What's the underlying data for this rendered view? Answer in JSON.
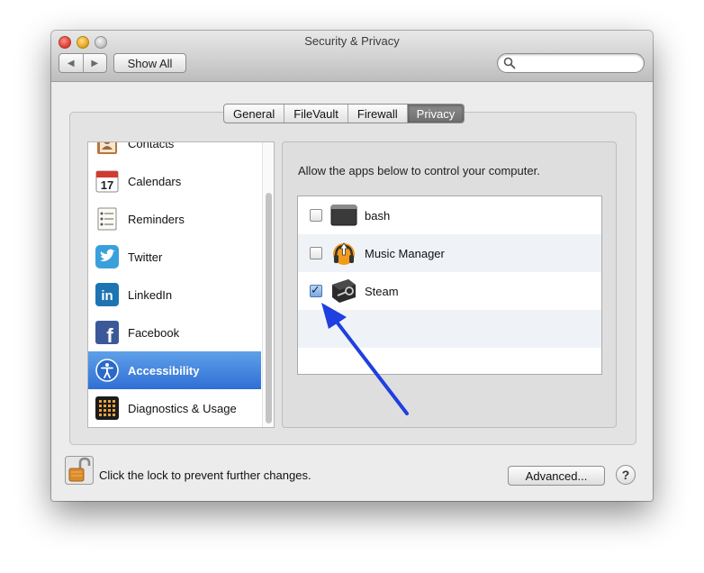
{
  "window": {
    "title": "Security & Privacy"
  },
  "toolbar": {
    "back_label": "◀",
    "forward_label": "▶",
    "show_all_label": "Show All",
    "search_placeholder": "",
    "search_value": ""
  },
  "tabs": [
    {
      "label": "General",
      "active": false
    },
    {
      "label": "FileVault",
      "active": false
    },
    {
      "label": "Firewall",
      "active": false
    },
    {
      "label": "Privacy",
      "active": true
    }
  ],
  "sidebar": {
    "items": [
      {
        "label": "Contacts",
        "icon": "contacts-icon"
      },
      {
        "label": "Calendars",
        "icon": "calendar-icon",
        "calendar_day": "17"
      },
      {
        "label": "Reminders",
        "icon": "reminders-icon"
      },
      {
        "label": "Twitter",
        "icon": "twitter-icon"
      },
      {
        "label": "LinkedIn",
        "icon": "linkedin-icon",
        "glyph": "in"
      },
      {
        "label": "Facebook",
        "icon": "facebook-icon",
        "glyph": "f"
      },
      {
        "label": "Accessibility",
        "icon": "accessibility-icon",
        "selected": true
      },
      {
        "label": "Diagnostics & Usage",
        "icon": "diagnostics-icon"
      }
    ]
  },
  "privacy_panel": {
    "instructions": "Allow the apps below to control your computer.",
    "apps": [
      {
        "name": "bash",
        "icon": "terminal-icon",
        "checked": false
      },
      {
        "name": "Music Manager",
        "icon": "music-manager-icon",
        "checked": false
      },
      {
        "name": "Steam",
        "icon": "steam-icon",
        "checked": true
      }
    ]
  },
  "footer": {
    "lock_text": "Click the lock to prevent further changes.",
    "advanced_label": "Advanced...",
    "help_label": "?"
  },
  "colors": {
    "selection": "#3b7bdc",
    "arrow": "#1f3fe0"
  }
}
